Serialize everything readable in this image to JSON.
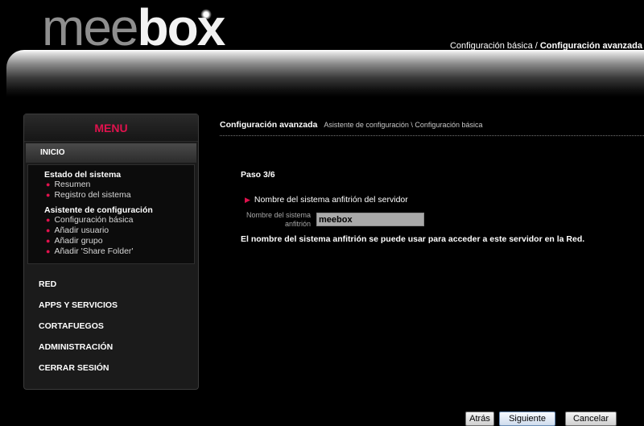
{
  "header": {
    "logo_left": "mee",
    "logo_right": "box",
    "nav_basic": "Configuración básica",
    "nav_separator": " / ",
    "nav_advanced": "Configuración avanzada"
  },
  "sidebar": {
    "title": "MENU",
    "home": "INICIO",
    "groups": [
      {
        "title": "Estado del sistema",
        "items": [
          "Resumen",
          "Registro del sistema"
        ]
      },
      {
        "title": "Asistente de configuración",
        "items": [
          "Configuración básica",
          "Añadir usuario",
          "Añadir grupo",
          "Añadir 'Share Folder'"
        ]
      }
    ],
    "bullet": "●",
    "menu_items": [
      "RED",
      "APPS Y SERVICIOS",
      "CORTAFUEGOS",
      "ADMINISTRACIÓN",
      "CERRAR SESIÓN"
    ]
  },
  "main": {
    "breadcrumb_current": "Configuración avanzada",
    "breadcrumb_path": "Asistente de configuración \\ Configuración básica",
    "step": "Paso 3/6",
    "section_marker": "▶",
    "section_title": "Nombre del sistema anfitrión del servidor",
    "field_label_line1": "Nombre del sistema",
    "field_label_line2": "anfitrión",
    "field_value": "meebox",
    "help_text": "El nombre del sistema anfitrión se puede usar para acceder a este servidor en la Red."
  },
  "buttons": {
    "back": "Atrás",
    "next": "Siguiente",
    "cancel": "Cancelar"
  },
  "colors": {
    "accent": "#e0124d",
    "background": "#000000"
  }
}
